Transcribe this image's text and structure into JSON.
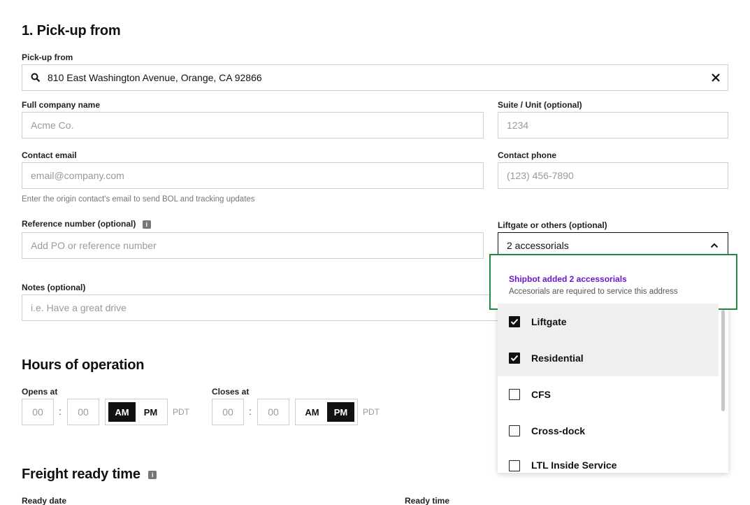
{
  "section": {
    "title": "1. Pick-up from"
  },
  "pickup": {
    "label": "Pick-up from",
    "value": "810 East Washington Avenue, Orange, CA 92866"
  },
  "company": {
    "label": "Full company name",
    "placeholder": "Acme Co."
  },
  "suite": {
    "label": "Suite / Unit (optional)",
    "placeholder": "1234"
  },
  "email": {
    "label": "Contact email",
    "placeholder": "email@company.com",
    "helper": "Enter the origin contact's email to send BOL and tracking updates"
  },
  "phone": {
    "label": "Contact phone",
    "placeholder": "(123) 456-7890"
  },
  "reference": {
    "label": "Reference number (optional)",
    "placeholder": "Add PO or reference number"
  },
  "notes": {
    "label": "Notes (optional)",
    "placeholder": "i.e. Have a great drive"
  },
  "liftgate": {
    "label": "Liftgate or others (optional)",
    "value": "2 accessorials",
    "banner_title": "Shipbot added 2 accessorials",
    "banner_text": "Accesorials are required to service this address",
    "options": [
      {
        "label": "Liftgate",
        "checked": true
      },
      {
        "label": "Residential",
        "checked": true
      },
      {
        "label": "CFS",
        "checked": false
      },
      {
        "label": "Cross-dock",
        "checked": false
      },
      {
        "label": "LTL Inside Service",
        "checked": false
      }
    ]
  },
  "hours": {
    "title": "Hours of operation",
    "opens": {
      "label": "Opens at",
      "hour": "00",
      "minute": "00",
      "am": "AM",
      "pm": "PM",
      "selected": "AM",
      "tz": "PDT"
    },
    "closes": {
      "label": "Closes at",
      "hour": "00",
      "minute": "00",
      "am": "AM",
      "pm": "PM",
      "selected": "PM",
      "tz": "PDT"
    }
  },
  "freight": {
    "title": "Freight ready time",
    "ready_date_label": "Ready date",
    "ready_time_label": "Ready time"
  },
  "colors": {
    "accent_purple": "#6a16c9",
    "highlight_green": "#1f8a3e"
  }
}
